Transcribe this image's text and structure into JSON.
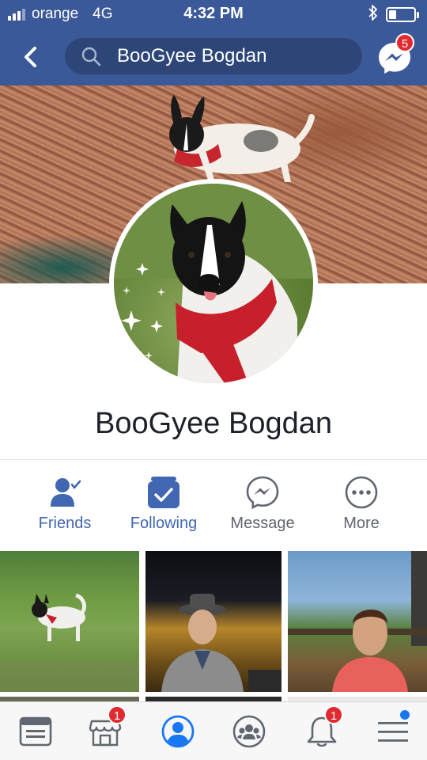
{
  "status_bar": {
    "carrier": "orange",
    "network": "4G",
    "time": "4:32 PM",
    "battery_level": 0.3
  },
  "header": {
    "search_value": "BooGyee Bogdan",
    "messenger_badge": "5"
  },
  "profile": {
    "name": "BooGyee Bogdan"
  },
  "actions": [
    {
      "label": "Friends",
      "icon": "friends-icon",
      "active": true
    },
    {
      "label": "Following",
      "icon": "following-icon",
      "active": true
    },
    {
      "label": "Message",
      "icon": "messenger-icon",
      "active": false
    },
    {
      "label": "More",
      "icon": "more-icon",
      "active": false
    }
  ],
  "tabbar": {
    "items": [
      {
        "icon": "news-feed-icon"
      },
      {
        "icon": "marketplace-icon",
        "badge": "1"
      },
      {
        "icon": "profile-icon",
        "active": true
      },
      {
        "icon": "groups-icon"
      },
      {
        "icon": "notifications-icon",
        "badge": "1"
      },
      {
        "icon": "menu-icon",
        "dot": true
      }
    ]
  },
  "colors": {
    "brand": "#3b5998",
    "accent_blue": "#4267b2",
    "badge_red": "#e02a30"
  }
}
